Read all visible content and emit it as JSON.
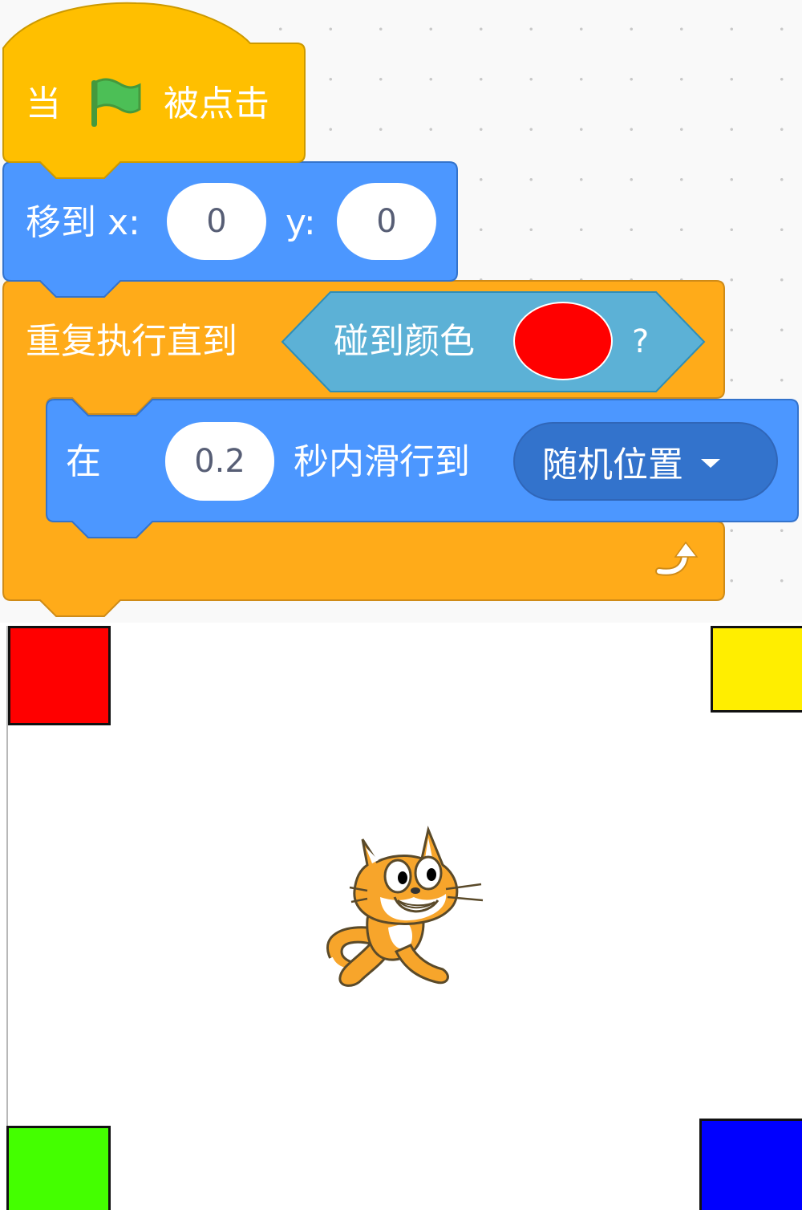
{
  "code_area": {
    "hat_block": {
      "label_before": "当",
      "label_after": "被点击",
      "color": "#ffbf00",
      "icon": "green-flag-icon"
    },
    "motion_goto": {
      "label": "移到 x:",
      "x_value": "0",
      "y_label": "y:",
      "y_value": "0",
      "color": "#4c97ff"
    },
    "repeat_until": {
      "label": "重复执行直到",
      "color": "#ffab19",
      "loop_arrow_icon": "loop-arrow-icon",
      "condition": {
        "label": "碰到颜色",
        "color_value": "#ff0000",
        "suffix": "?",
        "block_color": "#5cb1d6"
      }
    },
    "glide_block": {
      "label_prefix": "在",
      "seconds": "0.2",
      "label_middle": "秒内滑行到",
      "target": "随机位置",
      "color": "#4c97ff"
    }
  },
  "stage": {
    "sprite": "scratch-cat",
    "corner_squares": [
      {
        "name": "top-left",
        "color": "#ff0000"
      },
      {
        "name": "top-right",
        "color": "#ffee00"
      },
      {
        "name": "bottom-left",
        "color": "#44ff00"
      },
      {
        "name": "bottom-right",
        "color": "#0000ff"
      }
    ]
  }
}
